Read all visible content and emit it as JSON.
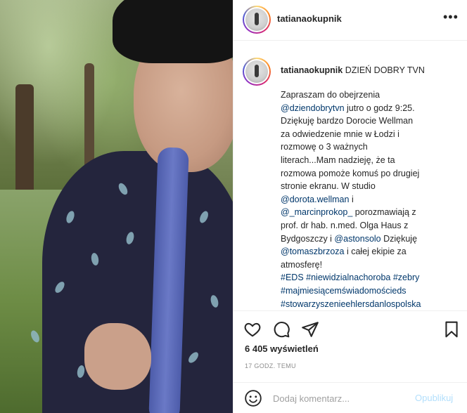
{
  "post": {
    "username": "tatianaokupnik",
    "caption_title": "DZIEŃ DOBRY TVN",
    "caption_segments": [
      {
        "text": "Zapraszam do obejrzenia\n",
        "link": false
      },
      {
        "text": "@dziendobrytvn",
        "link": true
      },
      {
        "text": " jutro o godz 9:25.\nDziękuję bardzo Dorocie Wellman\nza odwiedzenie mnie w Łodzi i\nrozmowę o 3 ważnych\nliterach...Mam nadzieję, że ta\nrozmowa pomoże komuś po drugiej\nstronie ekranu. W studio\n",
        "link": false
      },
      {
        "text": "@dorota.wellman",
        "link": true
      },
      {
        "text": " i\n",
        "link": false
      },
      {
        "text": "@_marcinprokop_",
        "link": true
      },
      {
        "text": " porozmawiają z\nprof. dr hab. n.med. Olga Haus z\nBydgoszczy i ",
        "link": false
      },
      {
        "text": "@astonsolo",
        "link": true
      },
      {
        "text": " Dziękuję\n",
        "link": false
      },
      {
        "text": "@tomaszbrzoza",
        "link": true
      },
      {
        "text": " i całej ekipie za\natmosferę!\n",
        "link": false
      },
      {
        "text": "#EDS",
        "link": true
      },
      {
        "text": " ",
        "link": false
      },
      {
        "text": "#niewidzialnachoroba",
        "link": true
      },
      {
        "text": " ",
        "link": false
      },
      {
        "text": "#zebry",
        "link": true
      },
      {
        "text": "\n",
        "link": false
      },
      {
        "text": "#majmiesiącemświadomościeds",
        "link": true
      },
      {
        "text": "\n",
        "link": false
      },
      {
        "text": "#stowarzyszenieehlersdanlospolska",
        "link": true
      }
    ],
    "views": "6 405 wyświetleń",
    "time_ago": "17 GODZ. TEMU"
  },
  "header": {
    "more_label": "•••"
  },
  "comment_box": {
    "placeholder": "Dodaj komentarz...",
    "post_label": "Opublikuj"
  },
  "colors": {
    "link": "#00376b",
    "post_disabled": "#b2dffc",
    "meta": "#8e8e8e"
  },
  "icons": [
    "heart-icon",
    "comment-icon",
    "share-icon",
    "bookmark-icon",
    "emoji-icon",
    "more-icon"
  ]
}
